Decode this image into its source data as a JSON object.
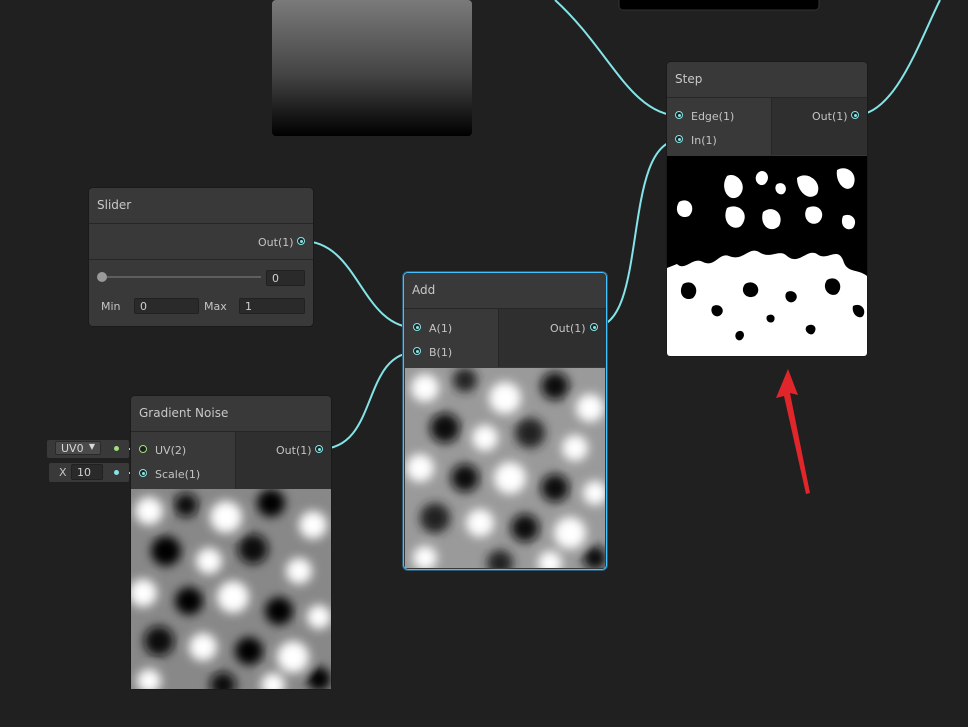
{
  "nodes": {
    "step": {
      "title": "Step",
      "inputs": [
        "Edge(1)",
        "In(1)"
      ],
      "output": "Out(1)"
    },
    "slider": {
      "title": "Slider",
      "output": "Out(1)",
      "value": "0",
      "min_label": "Min",
      "min_value": "0",
      "max_label": "Max",
      "max_value": "1",
      "slider_level": 0
    },
    "add": {
      "title": "Add",
      "inputs": [
        "A(1)",
        "B(1)"
      ],
      "output": "Out(1)"
    },
    "gradient_noise": {
      "title": "Gradient Noise",
      "inputs": [
        "UV(2)",
        "Scale(1)"
      ],
      "output": "Out(1)"
    }
  },
  "inline_inputs": {
    "uv_channel": "UV0",
    "scale_axis": "X",
    "scale_value": "10"
  },
  "colors": {
    "background": "#202020",
    "node_body": "#393939",
    "wire_float": "#84e4e7",
    "wire_vector2": "#9ee07c",
    "selection": "#44c0ff",
    "annotation_arrow": "#e0262b"
  }
}
